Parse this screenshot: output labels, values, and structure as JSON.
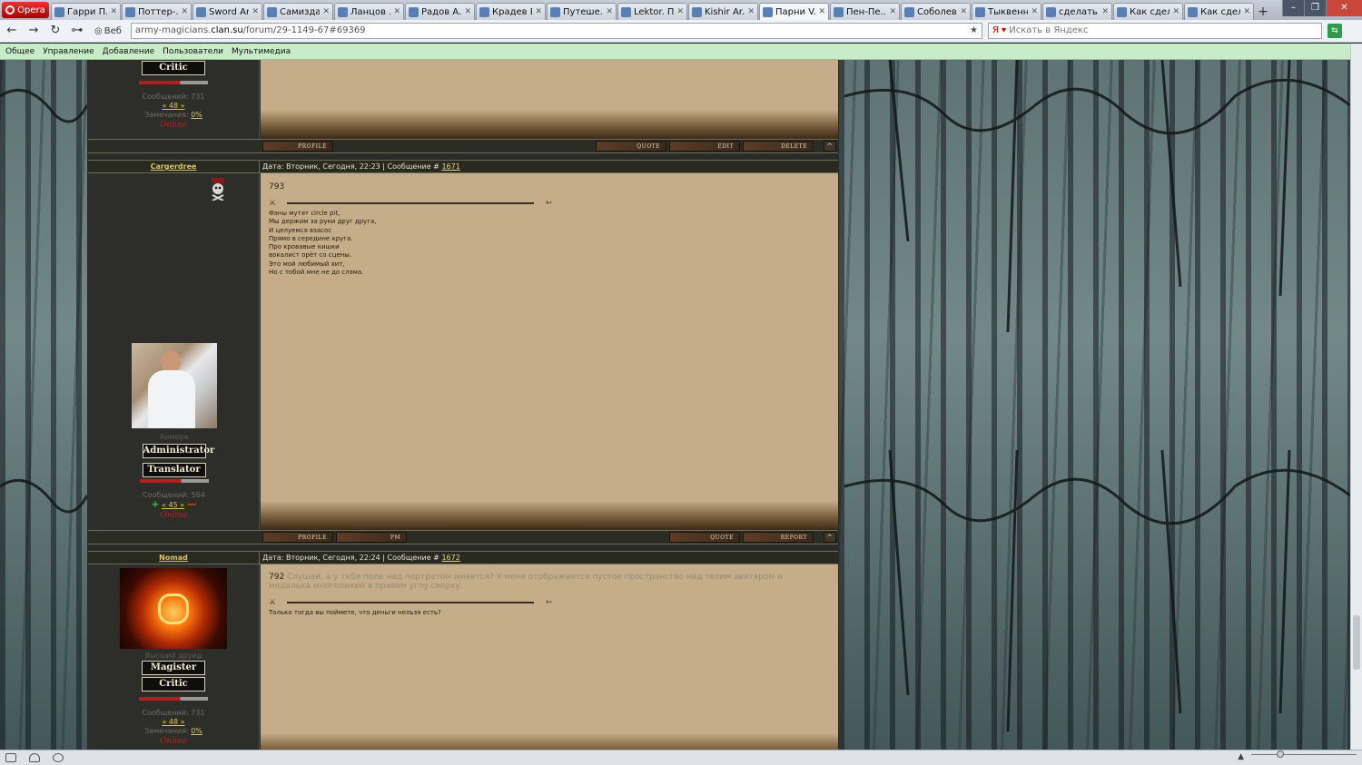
{
  "browser": {
    "opera_label": "Opera",
    "tabs": [
      {
        "title": "Гарри П..."
      },
      {
        "title": "Поттер-..."
      },
      {
        "title": "Sword Ar..."
      },
      {
        "title": "Самизда..."
      },
      {
        "title": "Ланцов ..."
      },
      {
        "title": "Радов А..."
      },
      {
        "title": "Крадев В..."
      },
      {
        "title": "Путеше..."
      },
      {
        "title": "Lektor. П..."
      },
      {
        "title": "Kishir Ar..."
      },
      {
        "title": "Парни V..."
      },
      {
        "title": "Пен-Пе..."
      },
      {
        "title": "Соболев..."
      },
      {
        "title": "Тыквенн..."
      },
      {
        "title": "сделать ..."
      },
      {
        "title": "Как сдел..."
      },
      {
        "title": "Как сдел..."
      }
    ],
    "active_tab_index": 10,
    "web_badge": "Веб",
    "url_prefix": "army-magicians.",
    "url_domain": "clan.su",
    "url_path": "/forum/29-1149-67#69369",
    "search_placeholder": "Искать в Яндекс"
  },
  "site_menu": [
    "Общее",
    "Управление",
    "Добавление",
    "Пользователи",
    "Мультимедиа"
  ],
  "post_prev_tail": {
    "rank": "Critic",
    "messages": "Сообщений: 731",
    "reputation": "« 48 »",
    "warnings_label": "Замечания:",
    "warnings_value": "0%",
    "status": "Online",
    "buttons": [
      "PROFILE",
      "QUOTE",
      "EDIT",
      "DELETE"
    ]
  },
  "post1": {
    "author": "Cargerdree",
    "meta_prefix": "Дата: Вторник, Сегодня, 22:23 | Сообщение #",
    "meta_num": "1671",
    "number": "793",
    "signature": [
      "Фэны мутят circle pit,",
      "Мы держим за руки друг друга,",
      "И целуемся взасос",
      "Прямо в середине круга.",
      "Про кровавые кишки",
      "вокалист орёт со сцены.",
      "Это мой любимый хит,",
      "Но с тобой мне не до слэма."
    ],
    "user_title": "Химера",
    "ranks": [
      "Administrator",
      "Translator"
    ],
    "messages": "Сообщений: 564",
    "reputation": "« 45 »",
    "status": "Online",
    "buttons": [
      "PROFILE",
      "PM",
      "QUOTE",
      "REPORT"
    ]
  },
  "post2": {
    "author": "Nomad",
    "meta_prefix": "Дата: Вторник, Сегодня, 22:24 | Сообщение #",
    "meta_num": "1672",
    "number": "792",
    "quote_text": "Слушай, а у тебя поле над портретом имеется? У меня отображается пустое пространство над твоим аватаром и медалька многоликий в правом углу сверху.",
    "signature": [
      "Только тогда вы поймете, что деньги нельзя есть?"
    ],
    "user_title": "Высший друид",
    "ranks": [
      "Magister",
      "Critic"
    ],
    "messages": "Сообщений: 731",
    "reputation": "« 48 »",
    "warnings_label": "Замечания:",
    "warnings_value": "0%",
    "status": "Online"
  }
}
